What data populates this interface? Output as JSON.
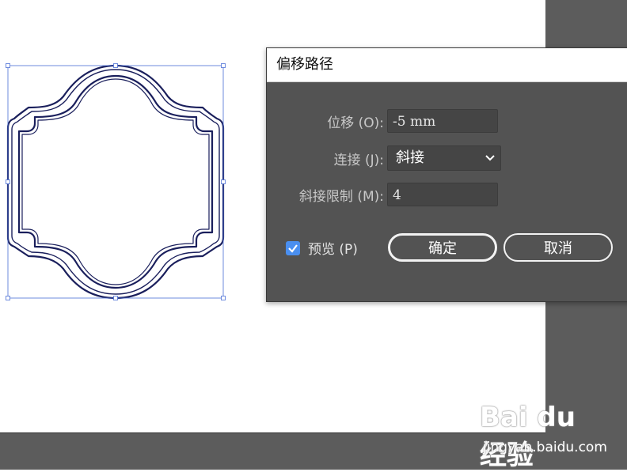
{
  "dialog": {
    "title": "偏移路径",
    "offset": {
      "label": "位移 (O):",
      "value": "-5 mm"
    },
    "joins": {
      "label": "连接 (J):",
      "value": "斜接"
    },
    "miter_limit": {
      "label": "斜接限制 (M):",
      "value": "4"
    },
    "preview": {
      "label": "预览 (P)",
      "checked": true
    },
    "ok_label": "确定",
    "cancel_label": "取消"
  },
  "watermark": {
    "logo": "Bai du 经验",
    "url": "jingyan.baidu.com"
  },
  "colors": {
    "dialog_bg": "#535353",
    "workspace_bg": "#5c5c5c",
    "selection": "#4a6fd6",
    "shape_stroke": "#1a1f5c",
    "checkbox": "#4a8ff0"
  }
}
